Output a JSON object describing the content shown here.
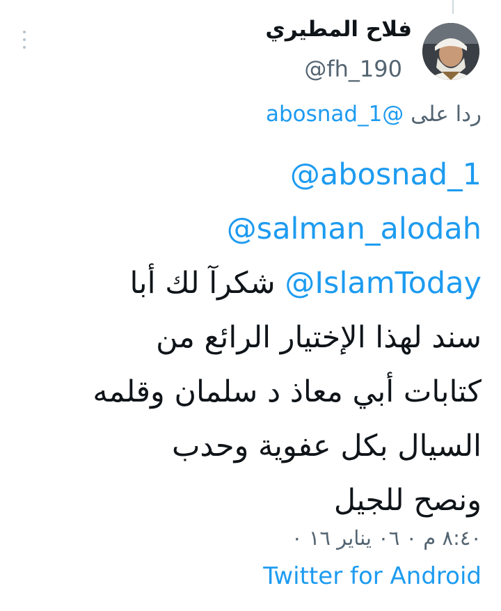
{
  "tweet": {
    "author": {
      "display_name": "فلاح المطيري",
      "handle": "@fh_190"
    },
    "reply_to": {
      "prefix": "ردا على",
      "mention": "@abosnad_1"
    },
    "body": {
      "mention_1": "@abosnad_1",
      "mention_2": "@salman_alodah",
      "mention_3": "@IslamToday",
      "line_3_text": "شكرآ لك أبا",
      "line_4": "سند لهذا الإختيار الرائع من",
      "line_5": "كتابات أبي معاذ د سلمان وقلمه",
      "line_6": "السيال بكل عفوية وحدب",
      "line_7": "ونصح للجيل"
    },
    "timestamp": "٨:٤٠ م ٠ ٠٦ يناير ١٦ ٠",
    "source": "Twitter for Android"
  },
  "colors": {
    "accent": "#1d9bf0",
    "secondary_text": "#536471",
    "primary_text": "#0f1419"
  },
  "icons": {
    "more": "vertical-ellipsis"
  }
}
